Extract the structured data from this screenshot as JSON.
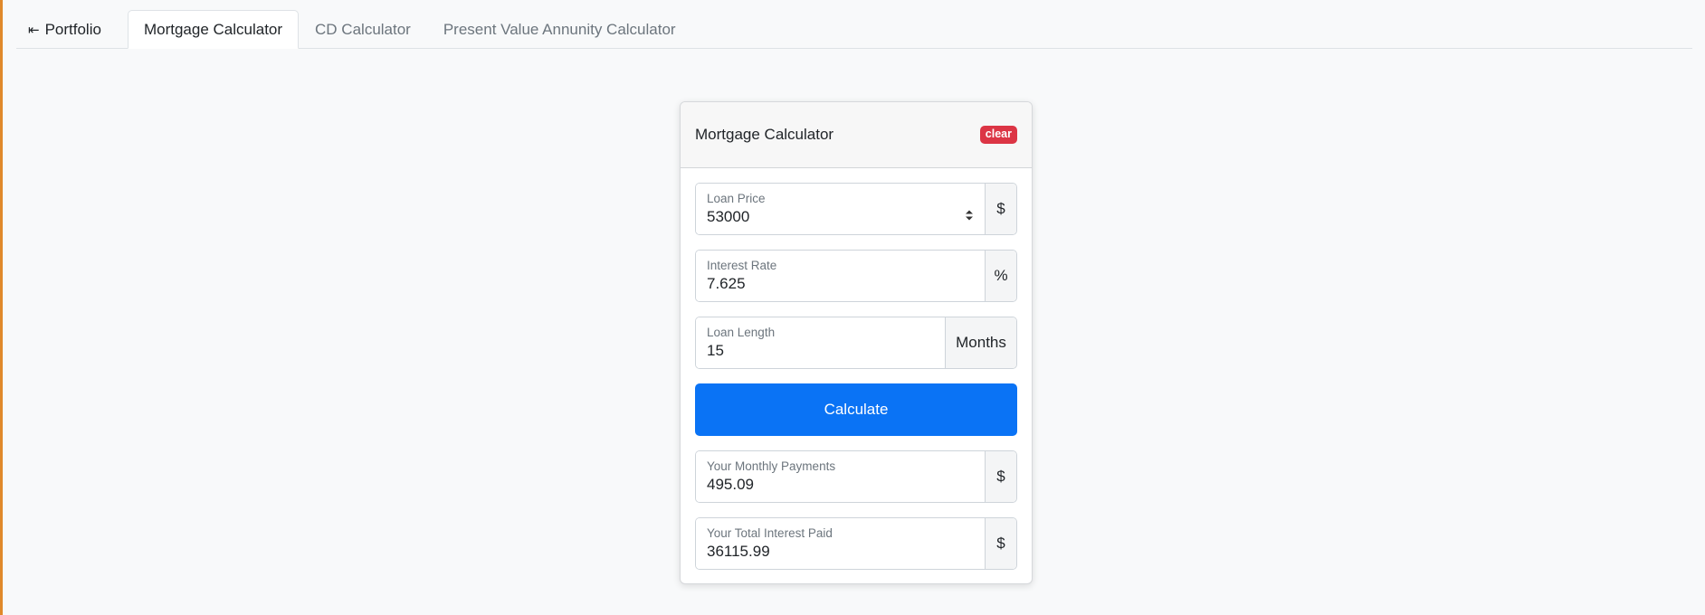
{
  "tabs": {
    "back_label": "Portfolio",
    "back_icon": "arrow-left-bar-icon",
    "items": [
      {
        "label": "Mortgage Calculator",
        "active": true
      },
      {
        "label": "CD Calculator",
        "active": false
      },
      {
        "label": "Present Value Annunity Calculator",
        "active": false
      }
    ]
  },
  "card": {
    "title": "Mortgage Calculator",
    "clear_label": "clear",
    "loan_price": {
      "label": "Loan Price",
      "value": "53000",
      "suffix": "$"
    },
    "interest_rate": {
      "label": "Interest Rate",
      "value": "7.625",
      "suffix": "%"
    },
    "loan_length": {
      "label": "Loan Length",
      "value": "15",
      "suffix": "Months"
    },
    "calculate_label": "Calculate",
    "monthly_payments": {
      "label": "Your Monthly Payments",
      "value": "495.09",
      "suffix": "$"
    },
    "total_interest": {
      "label": "Your Total Interest Paid",
      "value": "36115.99",
      "suffix": "$"
    }
  },
  "colors": {
    "primary": "#0a73f5",
    "danger": "#dc3545",
    "accent_border": "#e0892b"
  }
}
